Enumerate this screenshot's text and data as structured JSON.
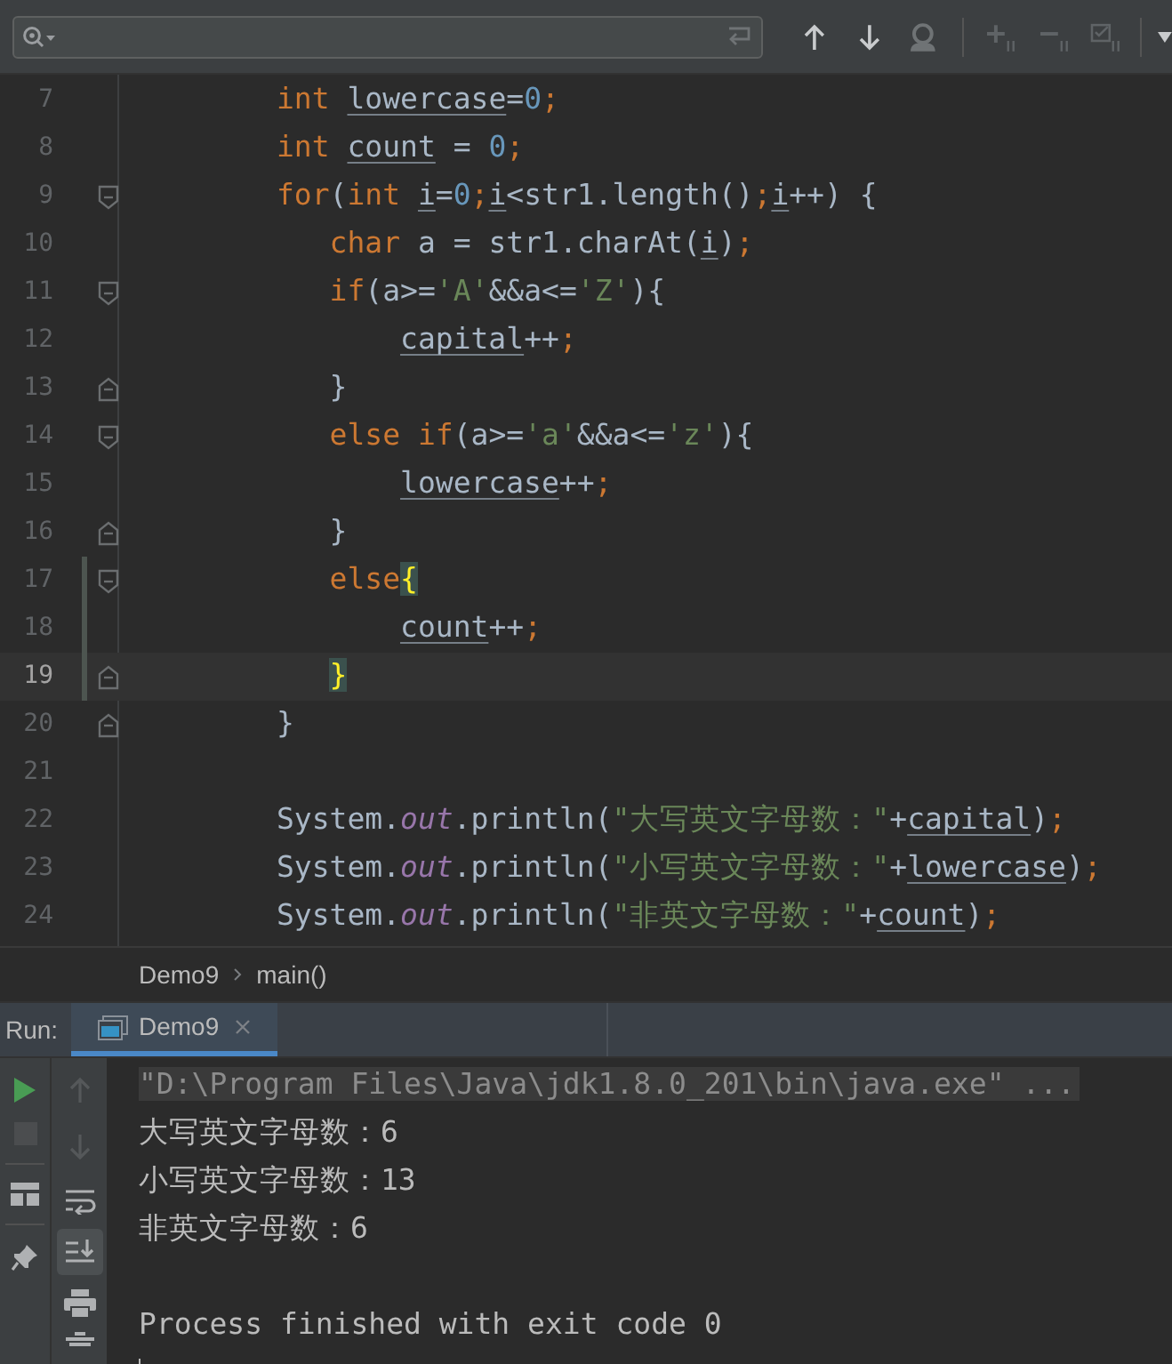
{
  "editor": {
    "lines": [
      {
        "number": "7",
        "current": false,
        "changed": false,
        "fold_start": false,
        "fold_end": false,
        "tokens": [
          {
            "kind": "kw",
            "text": "        int "
          },
          {
            "kind": "var",
            "text": "lowercase"
          },
          {
            "kind": "plain",
            "text": "="
          },
          {
            "kind": "num",
            "text": "0"
          },
          {
            "kind": "semi",
            "text": ";"
          }
        ]
      },
      {
        "number": "8",
        "current": false,
        "changed": false,
        "fold_start": false,
        "fold_end": false,
        "tokens": [
          {
            "kind": "kw",
            "text": "        int "
          },
          {
            "kind": "var",
            "text": "count"
          },
          {
            "kind": "plain",
            "text": " = "
          },
          {
            "kind": "num",
            "text": "0"
          },
          {
            "kind": "semi",
            "text": ";"
          }
        ]
      },
      {
        "number": "9",
        "current": false,
        "changed": false,
        "fold_start": true,
        "fold_end": false,
        "tokens": [
          {
            "kind": "kw",
            "text": "        for"
          },
          {
            "kind": "plain",
            "text": "("
          },
          {
            "kind": "kw",
            "text": "int "
          },
          {
            "kind": "var",
            "text": "i"
          },
          {
            "kind": "plain",
            "text": "="
          },
          {
            "kind": "num",
            "text": "0"
          },
          {
            "kind": "semi",
            "text": ";"
          },
          {
            "kind": "var",
            "text": "i"
          },
          {
            "kind": "plain",
            "text": "<str1.length()"
          },
          {
            "kind": "semi",
            "text": ";"
          },
          {
            "kind": "var",
            "text": "i"
          },
          {
            "kind": "plain",
            "text": "++) {"
          }
        ]
      },
      {
        "number": "10",
        "current": false,
        "changed": false,
        "fold_start": false,
        "fold_end": false,
        "tokens": [
          {
            "kind": "kw",
            "text": "           char"
          },
          {
            "kind": "plain",
            "text": " a = str1.charAt("
          },
          {
            "kind": "var",
            "text": "i"
          },
          {
            "kind": "plain",
            "text": ")"
          },
          {
            "kind": "semi",
            "text": ";"
          }
        ]
      },
      {
        "number": "11",
        "current": false,
        "changed": false,
        "fold_start": true,
        "fold_end": false,
        "tokens": [
          {
            "kind": "kw",
            "text": "           if"
          },
          {
            "kind": "plain",
            "text": "(a>="
          },
          {
            "kind": "str",
            "text": "'A'"
          },
          {
            "kind": "plain",
            "text": "&&a<="
          },
          {
            "kind": "str",
            "text": "'Z'"
          },
          {
            "kind": "plain",
            "text": "){"
          }
        ]
      },
      {
        "number": "12",
        "current": false,
        "changed": false,
        "fold_start": false,
        "fold_end": false,
        "tokens": [
          {
            "kind": "var",
            "text": "               capital"
          },
          {
            "kind": "plain",
            "text": "++"
          },
          {
            "kind": "semi",
            "text": ";"
          }
        ]
      },
      {
        "number": "13",
        "current": false,
        "changed": false,
        "fold_start": false,
        "fold_end": true,
        "tokens": [
          {
            "kind": "plain",
            "text": "           }"
          }
        ]
      },
      {
        "number": "14",
        "current": false,
        "changed": false,
        "fold_start": true,
        "fold_end": false,
        "tokens": [
          {
            "kind": "kw",
            "text": "           else if"
          },
          {
            "kind": "plain",
            "text": "(a>="
          },
          {
            "kind": "str",
            "text": "'a'"
          },
          {
            "kind": "plain",
            "text": "&&a<="
          },
          {
            "kind": "str",
            "text": "'z'"
          },
          {
            "kind": "plain",
            "text": "){"
          }
        ]
      },
      {
        "number": "15",
        "current": false,
        "changed": false,
        "fold_start": false,
        "fold_end": false,
        "tokens": [
          {
            "kind": "var",
            "text": "               lowercase"
          },
          {
            "kind": "plain",
            "text": "++"
          },
          {
            "kind": "semi",
            "text": ";"
          }
        ]
      },
      {
        "number": "16",
        "current": false,
        "changed": false,
        "fold_start": false,
        "fold_end": true,
        "tokens": [
          {
            "kind": "plain",
            "text": "           }"
          }
        ]
      },
      {
        "number": "17",
        "current": false,
        "changed": true,
        "fold_start": true,
        "fold_end": false,
        "tokens": [
          {
            "kind": "kw",
            "text": "           else"
          },
          {
            "kind": "match",
            "text": "{"
          }
        ]
      },
      {
        "number": "18",
        "current": false,
        "changed": true,
        "fold_start": false,
        "fold_end": false,
        "tokens": [
          {
            "kind": "var",
            "text": "               count"
          },
          {
            "kind": "plain",
            "text": "++"
          },
          {
            "kind": "semi",
            "text": ";"
          }
        ]
      },
      {
        "number": "19",
        "current": true,
        "changed": true,
        "fold_start": false,
        "fold_end": true,
        "tokens": [
          {
            "kind": "match",
            "text": "           }"
          }
        ]
      },
      {
        "number": "20",
        "current": false,
        "changed": false,
        "fold_start": false,
        "fold_end": true,
        "tokens": [
          {
            "kind": "plain",
            "text": "        }"
          }
        ]
      },
      {
        "number": "21",
        "current": false,
        "changed": false,
        "fold_start": false,
        "fold_end": false
      },
      {
        "number": "22",
        "current": false,
        "changed": false,
        "fold_start": false,
        "fold_end": false,
        "tokens": [
          {
            "kind": "plain",
            "text": "        System."
          },
          {
            "kind": "field",
            "text": "out"
          },
          {
            "kind": "plain",
            "text": ".println("
          },
          {
            "kind": "str",
            "text": "\"大写英文字母数：\""
          },
          {
            "kind": "plain",
            "text": "+"
          },
          {
            "kind": "var",
            "text": "capital"
          },
          {
            "kind": "plain",
            "text": ")"
          },
          {
            "kind": "semi",
            "text": ";"
          }
        ]
      },
      {
        "number": "23",
        "current": false,
        "changed": false,
        "fold_start": false,
        "fold_end": false,
        "tokens": [
          {
            "kind": "plain",
            "text": "        System."
          },
          {
            "kind": "field",
            "text": "out"
          },
          {
            "kind": "plain",
            "text": ".println("
          },
          {
            "kind": "str",
            "text": "\"小写英文字母数：\""
          },
          {
            "kind": "plain",
            "text": "+"
          },
          {
            "kind": "var",
            "text": "lowercase"
          },
          {
            "kind": "plain",
            "text": ")"
          },
          {
            "kind": "semi",
            "text": ";"
          }
        ]
      },
      {
        "number": "24",
        "current": false,
        "changed": false,
        "fold_start": false,
        "fold_end": false,
        "tokens": [
          {
            "kind": "plain",
            "text": "        System."
          },
          {
            "kind": "field",
            "text": "out"
          },
          {
            "kind": "plain",
            "text": ".println("
          },
          {
            "kind": "str",
            "text": "\"非英文字母数：\""
          },
          {
            "kind": "plain",
            "text": "+"
          },
          {
            "kind": "var",
            "text": "count"
          },
          {
            "kind": "plain",
            "text": ")"
          },
          {
            "kind": "semi",
            "text": ";"
          }
        ]
      }
    ]
  },
  "breadcrumb": [
    "Demo9",
    "main()"
  ],
  "run_panel": {
    "label": "Run:",
    "tabs": [
      {
        "label": "Demo9",
        "selected": true
      }
    ],
    "autoscroll": {
      "on": true
    },
    "console": {
      "command": "\"D:\\Program Files\\Java\\jdk1.8.0_201\\bin\\java.exe\" ...",
      "output": [
        "大写英文字母数：6",
        "小写英文字母数：13",
        "非英文字母数：6"
      ],
      "exit_message": "Process finished with exit code 0"
    }
  }
}
